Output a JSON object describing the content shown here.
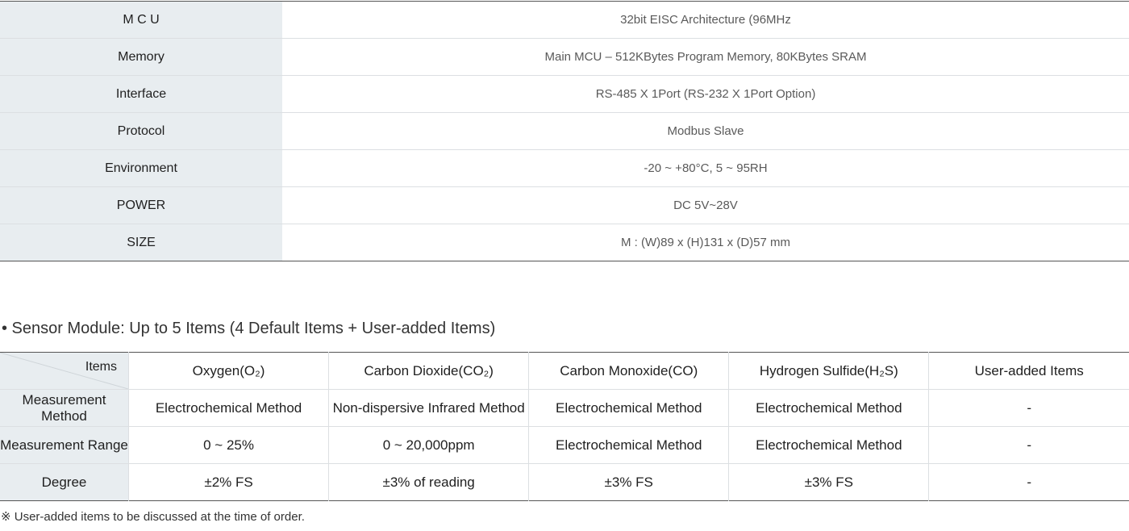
{
  "spec_table": {
    "rows": [
      {
        "label": "M C U",
        "value": "32bit EISC Architecture (96MHz"
      },
      {
        "label": "Memory",
        "value": "Main MCU – 512KBytes Program Memory, 80KBytes SRAM"
      },
      {
        "label": "Interface",
        "value": "RS-485 X 1Port (RS-232 X 1Port Option)"
      },
      {
        "label": "Protocol",
        "value": "Modbus Slave"
      },
      {
        "label": "Environment",
        "value": "-20 ~ +80°C, 5 ~ 95RH"
      },
      {
        "label": "POWER",
        "value": "DC 5V~28V"
      },
      {
        "label": "SIZE",
        "value": "M : (W)89 x (H)131 x (D)57 mm"
      }
    ]
  },
  "sensor_section": {
    "title": "• Sensor Module: Up to 5 Items (4 Default Items + User-added Items)",
    "corner_label": "Items",
    "columns": [
      "Oxygen(O₂)",
      "Carbon Dioxide(CO₂)",
      "Carbon Monoxide(CO)",
      "Hydrogen Sulfide(H₂S)",
      "User-added Items"
    ],
    "rows": [
      {
        "label": "Measurement Method",
        "cells": [
          "Electrochemical Method",
          "Non-dispersive Infrared Method",
          "Electrochemical Method",
          "Electrochemical Method",
          "-"
        ]
      },
      {
        "label": "Measurement Range",
        "cells": [
          "0 ~ 25%",
          "0 ~ 20,000ppm",
          "Electrochemical Method",
          "Electrochemical Method",
          "-"
        ]
      },
      {
        "label": "Degree",
        "cells": [
          "±2% FS",
          "±3% of reading",
          "±3% FS",
          "±3% FS",
          "-"
        ]
      }
    ],
    "footnote": "※ User-added items to be discussed at the time of order."
  }
}
